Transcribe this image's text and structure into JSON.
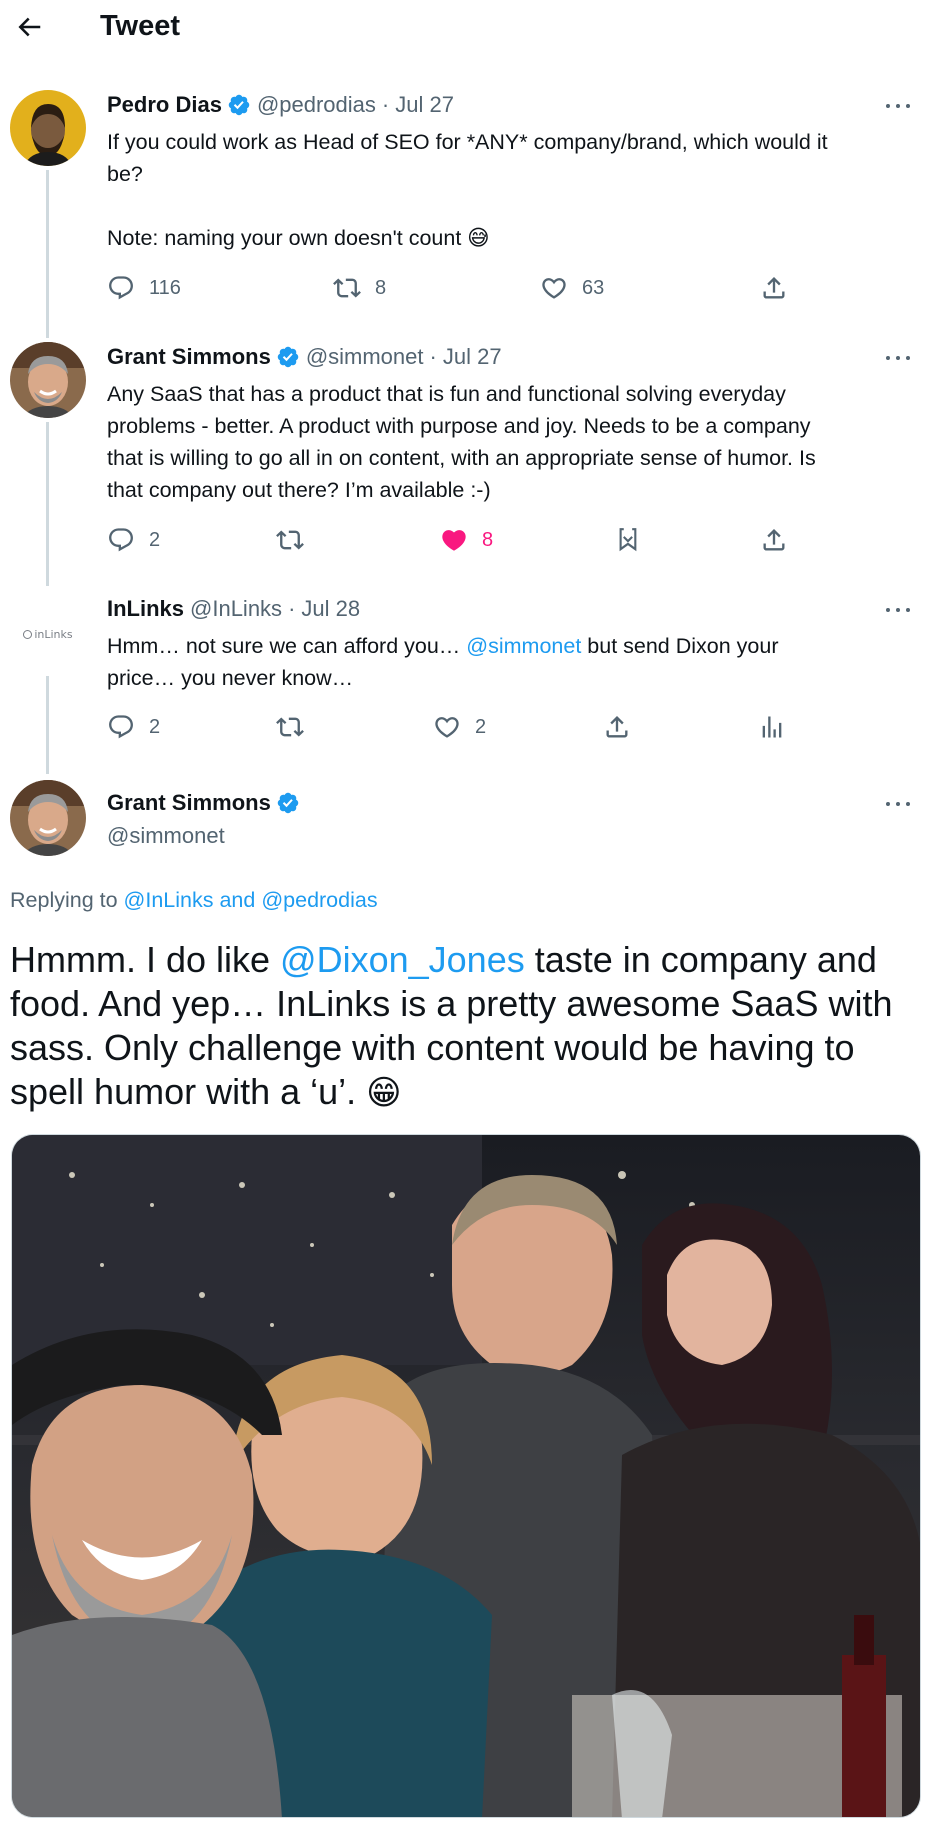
{
  "header": {
    "title": "Tweet"
  },
  "tweets": [
    {
      "name": "Pedro Dias",
      "handle": "@pedrodias",
      "sep": "·",
      "date": "Jul 27",
      "line1": "If you could work as Head of SEO for *ANY* company/brand, which would it",
      "line2": "be?",
      "line3": "Note: naming your own doesn't count",
      "emoji": "😅",
      "replies": "116",
      "retweets": "8",
      "likes": "63"
    },
    {
      "name": "Grant Simmons",
      "handle": "@simmonet",
      "sep": "·",
      "date": "Jul 27",
      "line1": "Any SaaS that has a product that is fun and functional solving everyday",
      "line2": "problems - better. A product with purpose and joy. Needs to be a company",
      "line3": "that is willing to go all in on content, with an appropriate sense of humor. Is",
      "line4": "that company out there? I’m available :-)",
      "replies": "2",
      "likes": "8"
    },
    {
      "name": "InLinks",
      "handle": "@InLinks",
      "sep": "·",
      "date": "Jul 28",
      "avatar_text": "inLinks",
      "line1_a": "Hmm… not sure we can afford you… ",
      "line1_mention": "@simmonet",
      "line1_b": " but send Dixon your",
      "line2": "price… you never know…",
      "replies": "2",
      "likes": "2"
    }
  ],
  "main": {
    "name": "Grant Simmons",
    "handle": "@simmonet",
    "replying_prefix": "Replying to ",
    "replying_to_1": "@InLinks",
    "replying_and": " and ",
    "replying_to_2": "@pedrodias",
    "text1": "Hmmm. I do like ",
    "text_mention": "@Dixon_Jones",
    "text2": " taste in company and",
    "text3": "food. And yep… InLinks is a pretty awesome SaaS with",
    "text4": "sass. Only challenge with content would be having to",
    "text5": "spell humor with a ‘u’. ",
    "emoji": "😁"
  },
  "colors": {
    "accent": "#1d9bf0",
    "like_active": "#f91880",
    "text_primary": "#0f1419",
    "text_secondary": "#536471",
    "thread_line": "#cfd9de"
  },
  "icons": [
    "back-arrow-icon",
    "verified-badge-icon",
    "more-icon",
    "reply-icon",
    "retweet-icon",
    "like-icon",
    "share-icon",
    "bookmark-icon",
    "analytics-icon"
  ]
}
